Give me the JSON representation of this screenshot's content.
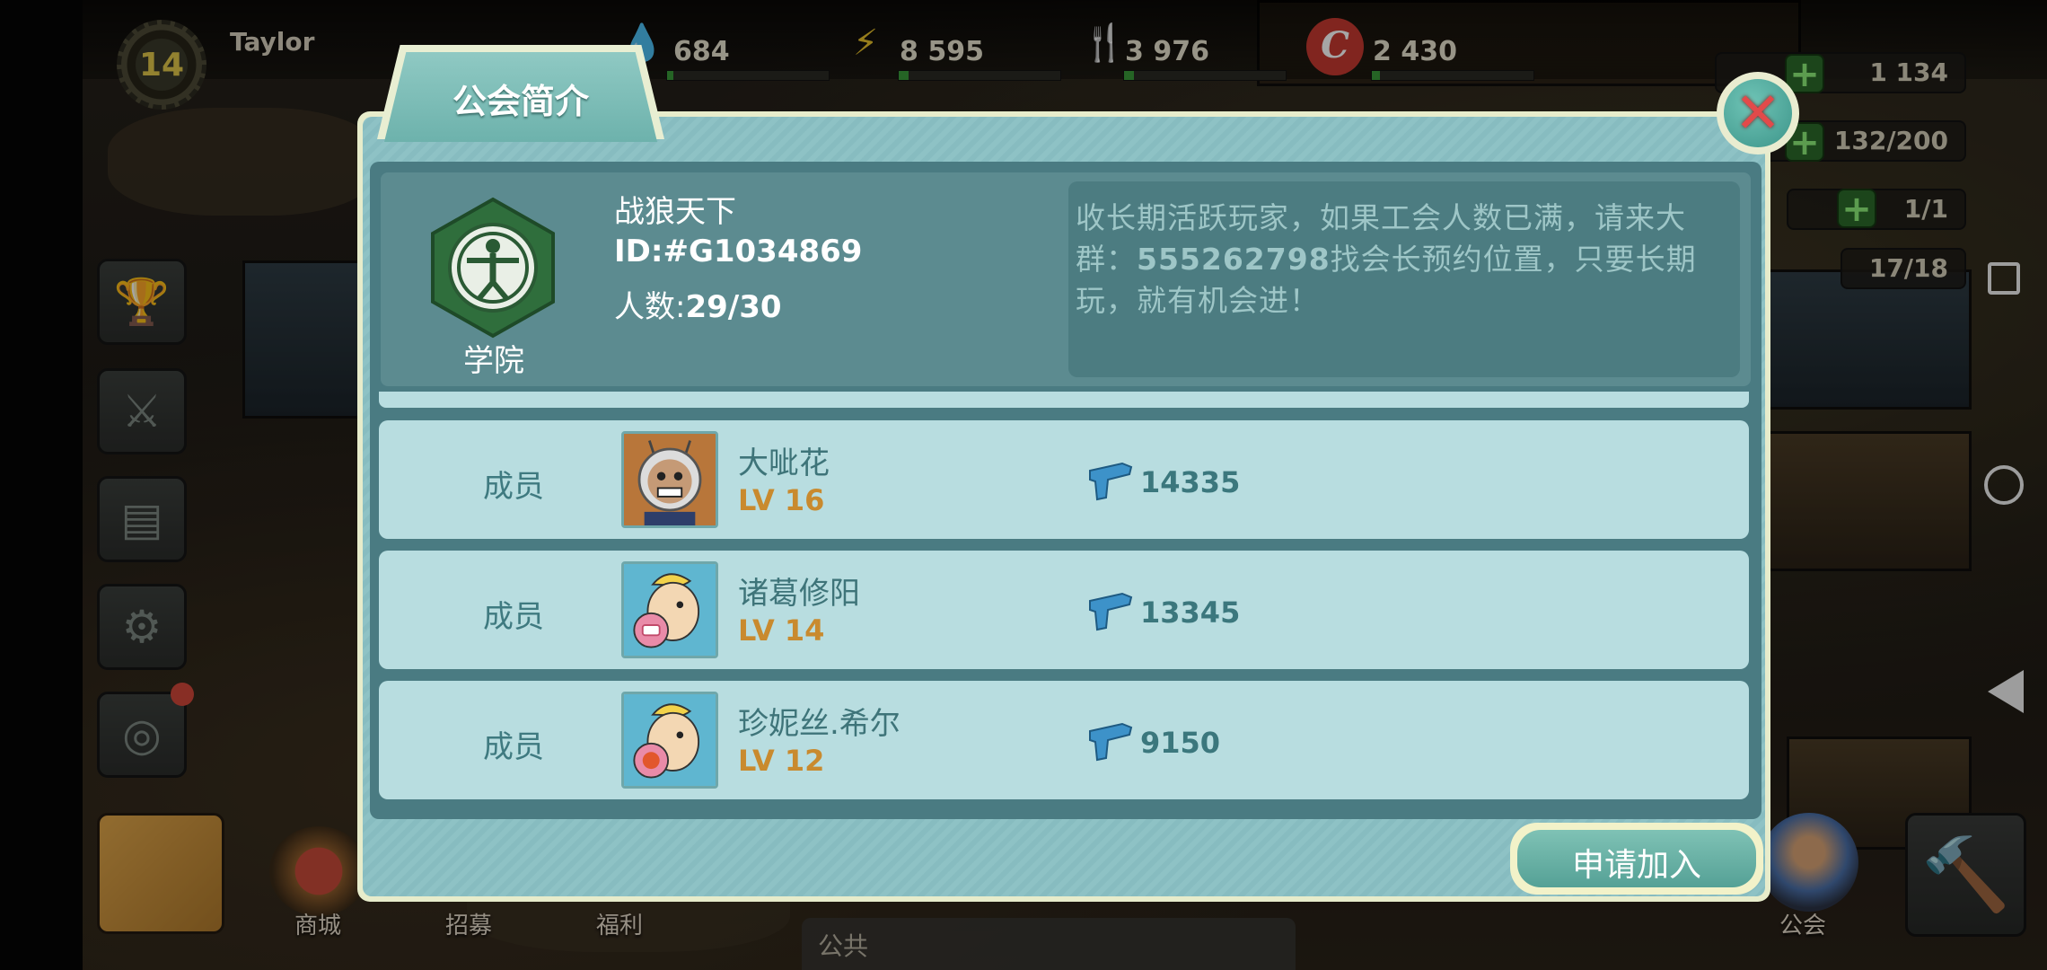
{
  "hud": {
    "level": "14",
    "player_name": "Taylor",
    "water": "684",
    "energy": "8 595",
    "food": "3 976",
    "caps": "2 430",
    "bottlecaps_right": "1 134",
    "stimpaks": "132/200",
    "radaway": "1/1",
    "dwellers": "17/18"
  },
  "bottom": {
    "shop": "商城",
    "recruit": "招募",
    "welfare": "福利",
    "public": "公共",
    "guild": "公会"
  },
  "dialog": {
    "tab_title": "公会简介",
    "close_icon": "close-x-icon",
    "guild": {
      "emblem": "vitruvian-emblem-icon",
      "type_label": "学院",
      "name": "战狼天下",
      "id": "ID:#G1034869",
      "count_label": "人数:",
      "count_value": "29/30",
      "description_part1": "收长期活跃玩家，如果工会人数已满，请来大群：",
      "description_number": "555262798",
      "description_part2": "找会长预约位置，只要长期玩，就有机会进！"
    },
    "members": [
      {
        "role": "成员",
        "name": "大呲花",
        "level": "LV 16",
        "power": "14335",
        "avatar": "astronaut-avatar"
      },
      {
        "role": "成员",
        "name": "诸葛修阳",
        "level": "LV 14",
        "power": "13345",
        "avatar": "vault-boy-gamepad-avatar"
      },
      {
        "role": "成员",
        "name": "珍妮丝.希尔",
        "level": "LV 12",
        "power": "9150",
        "avatar": "vault-boy-bird-avatar"
      }
    ],
    "join_button": "申请加入"
  },
  "colors": {
    "panel_teal": "#4a7b82",
    "row_bg": "#b8dde0",
    "level_orange": "#c98a2e",
    "close_red": "#e24a4a",
    "join_green": "#55a196"
  }
}
